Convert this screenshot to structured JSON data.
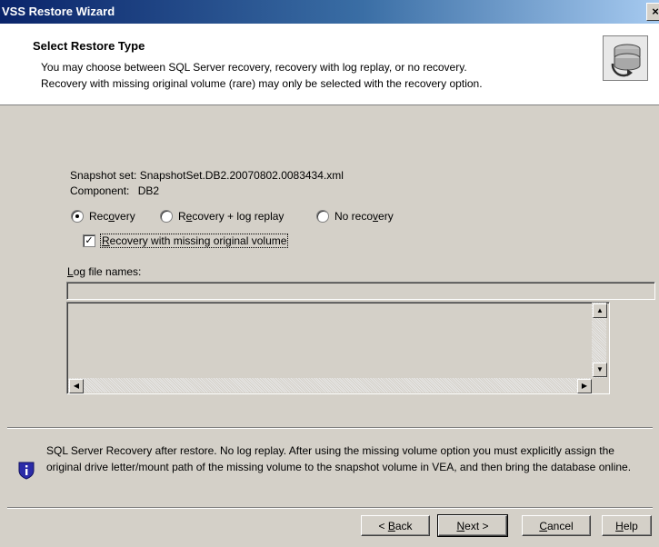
{
  "window": {
    "title": "VSS Restore Wizard",
    "close_glyph": "×"
  },
  "header": {
    "title": "Select Restore Type",
    "desc_line1": "You may choose between SQL Server recovery, recovery with log replay, or no recovery.",
    "desc_line2": "Recovery with missing original volume (rare) may only be selected with the recovery option.",
    "icon": "database-restore-icon"
  },
  "snapshot": {
    "set_label": "Snapshot set:",
    "set_value": "SnapshotSet.DB2.20070802.0083434.xml",
    "component_label": "Component:",
    "component_value": "DB2"
  },
  "options": {
    "radios": [
      {
        "pre": "Rec",
        "key": "o",
        "post": "very",
        "checked": true
      },
      {
        "pre": "R",
        "key": "e",
        "post": "covery + log replay",
        "checked": false
      },
      {
        "pre": "No reco",
        "key": "v",
        "post": "ery",
        "checked": false
      }
    ],
    "missing_volume": {
      "pre": "",
      "key": "R",
      "post": "ecovery with missing original volume",
      "checked": true
    }
  },
  "log": {
    "label_key": "L",
    "label_rest": "og file names:",
    "input_value": "",
    "items": []
  },
  "info": {
    "icon": "info-shield-icon",
    "text": "SQL Server Recovery after restore.  No log replay. After using the missing volume option you must explicitly assign the original drive letter/mount path of the missing volume to the snapshot volume in VEA, and then bring the database online."
  },
  "buttons": {
    "back": {
      "pre": "< ",
      "key": "B",
      "post": "ack"
    },
    "next": {
      "pre": "",
      "key": "N",
      "post": "ext >"
    },
    "cancel": {
      "pre": "",
      "key": "C",
      "post": "ancel"
    },
    "help": {
      "pre": "",
      "key": "H",
      "post": "elp"
    }
  },
  "colors": {
    "titlebar_start": "#0a246a",
    "titlebar_end": "#a6caf0",
    "face": "#d4d0c8",
    "info_icon": "#2b2ba8"
  }
}
